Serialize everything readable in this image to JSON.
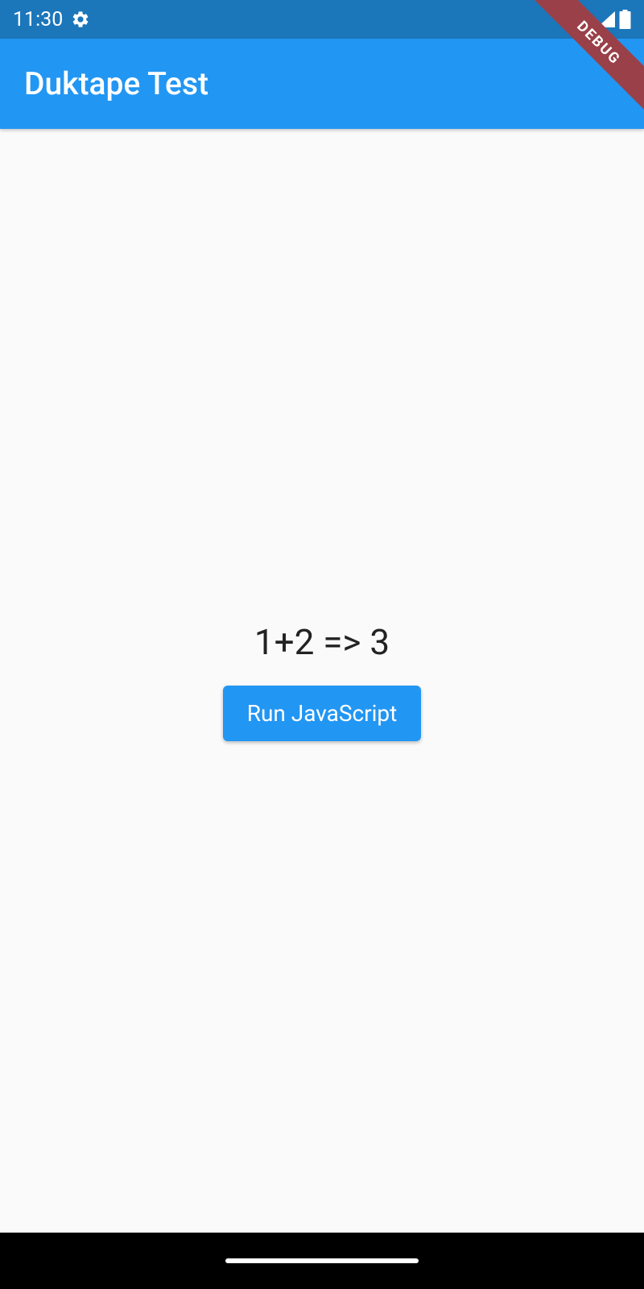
{
  "status_bar": {
    "time": "11:30",
    "icons": {
      "settings": "gear-icon",
      "wifi": "wifi-icon",
      "signal": "signal-icon",
      "battery": "battery-icon"
    }
  },
  "app_bar": {
    "title": "Duktape Test"
  },
  "debug_ribbon": {
    "label": "DEBUG"
  },
  "main": {
    "result_text": "1+2 => 3",
    "run_button_label": "Run JavaScript"
  },
  "colors": {
    "status_bar_bg": "#1c76ba",
    "app_bar_bg": "#2296f3",
    "button_bg": "#2296f3",
    "ribbon_bg": "#9a4048",
    "body_bg": "#fafafa"
  }
}
